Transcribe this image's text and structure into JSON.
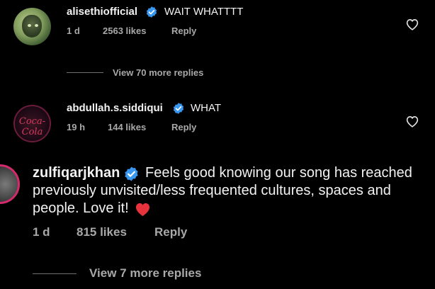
{
  "comments": [
    {
      "username": "alisethiofficial",
      "text": "WAIT WHATTTT",
      "time": "1 d",
      "likes": "2563 likes",
      "reply_label": "Reply"
    },
    {
      "username": "abdullah.s.siddiqui",
      "text": "WHAT",
      "time": "19 h",
      "likes": "144 likes",
      "reply_label": "Reply",
      "avatar_logo": "Coca-Cola"
    },
    {
      "username": "zulfiqarjkhan",
      "text_line1": "Feels good knowing our song has reached",
      "text_line2": "previously unvisited/less frequented cultures, spaces and",
      "text_line3": "people. Love it!",
      "time": "1 d",
      "likes": "815 likes",
      "reply_label": "Reply"
    }
  ],
  "view_more": [
    {
      "label": "View 70 more replies"
    },
    {
      "label": "View 7 more replies"
    }
  ],
  "icons": {
    "verified": "verified-badge-icon",
    "like": "heart-outline-icon",
    "emoji": "red-heart-emoji"
  },
  "colors": {
    "background": "#000000",
    "text": "#f2f2f2",
    "meta": "#a8a8a8",
    "verified": "#3897f0",
    "heart_emoji": "#e8323c",
    "story_ring": "#d22a6c"
  }
}
